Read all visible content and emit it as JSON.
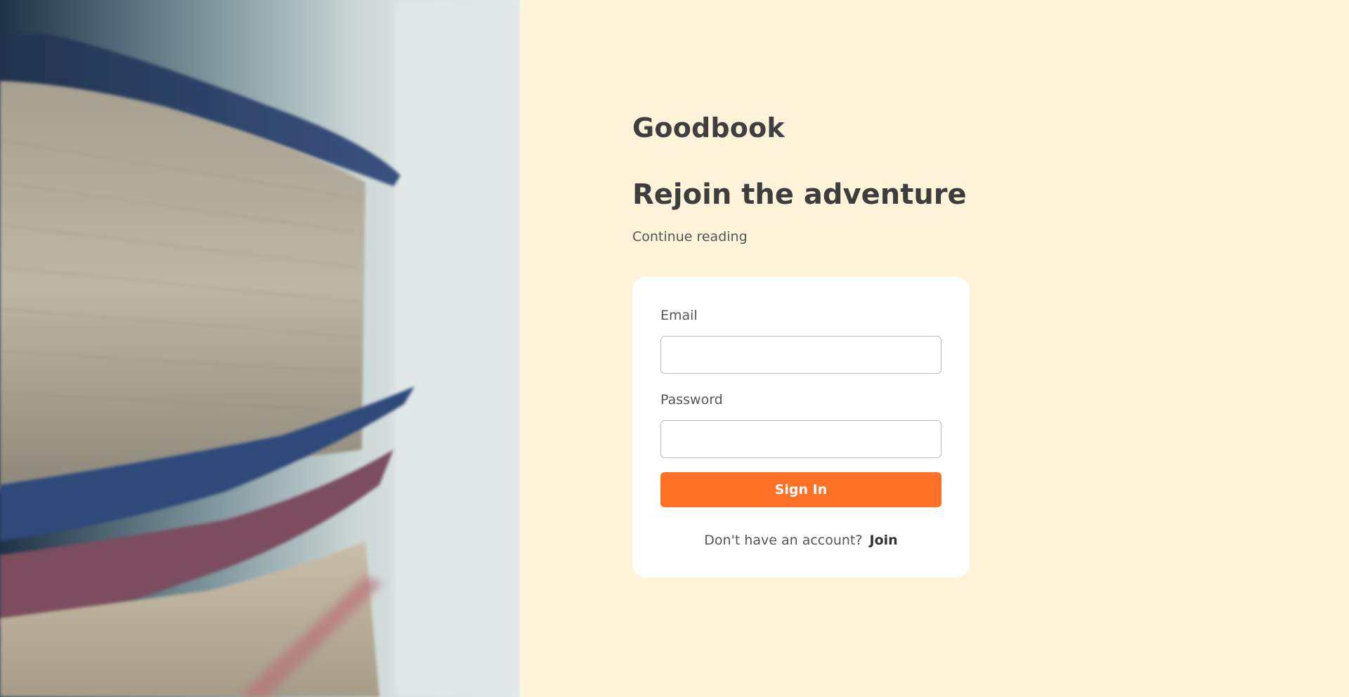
{
  "brand": "Goodbook",
  "headline": "Rejoin the adventure",
  "subheadline": "Continue reading",
  "form": {
    "email_label": "Email",
    "email_value": "",
    "password_label": "Password",
    "password_value": "",
    "submit_label": "Sign In",
    "signup_prompt": "Don't have an account?",
    "signup_link": "Join"
  },
  "colors": {
    "background": "#fff3d9",
    "card": "#ffffff",
    "accent": "#ff7126",
    "text_dark": "#3d3d3d",
    "text_muted": "#555555"
  },
  "hero_image": "stack-of-books-photo"
}
